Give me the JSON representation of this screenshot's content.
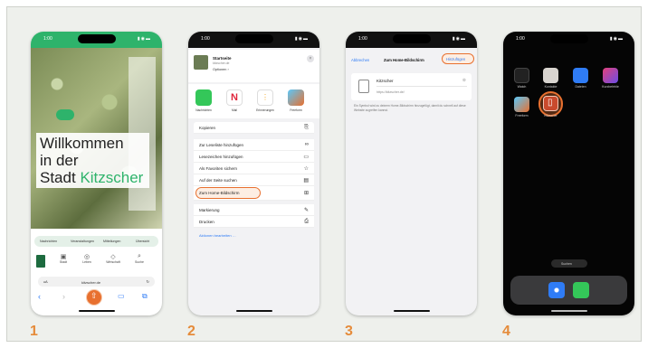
{
  "colors": {
    "accent_green": "#2eb36b",
    "highlight_orange": "#e8702f",
    "step_number": "#e58b3a",
    "ios_blue": "#2f7cf6"
  },
  "step_numbers": [
    "1",
    "2",
    "3",
    "4"
  ],
  "phone1": {
    "time": "1:00",
    "hero_line1": "Willkommen",
    "hero_line2": "in der",
    "hero_line3a": "Stadt",
    "hero_line3b": "Kitzscher",
    "chips": [
      "Nachrichten",
      "Veranstaltungen",
      "Mitteilungen"
    ],
    "chip_more": "Übersicht",
    "nav_items": [
      "Stadt",
      "Leben",
      "Wirtschaft",
      "Suche"
    ],
    "url": "kitzscher.de"
  },
  "phone2": {
    "time": "1:00",
    "page_title": "Startseite",
    "page_subtitle": "kitzscher.de",
    "options": "Optionen ›",
    "share_targets": [
      "Nachrichten",
      "Mail",
      "Erinnerungen",
      "Freeform"
    ],
    "menu_items": [
      "Kopieren",
      "Zur Leseliste hinzufügen",
      "Lesezeichen hinzufügen",
      "Als Favoriten sichern",
      "Auf der Seite suchen",
      "Zum Home-Bildschirm",
      "Markierung",
      "Drucken"
    ],
    "edit_actions": "Aktionen bearbeiten …"
  },
  "phone3": {
    "time": "1:00",
    "cancel": "Abbrechen",
    "title": "Zum Home-Bildschirm",
    "add": "Hinzufügen",
    "name_value": "Kitzscher",
    "url_value": "https://kitzscher.de/",
    "hint": "Ein Symbol wird zu deinem Home-Bildschirm hinzugefügt, damit du schnell auf diese Website zugreifen kannst."
  },
  "phone4": {
    "time": "1:00",
    "apps": [
      "Watch",
      "Kontakte",
      "Dateien",
      "Kurzbefehle",
      "Freeform",
      "Kitzscher"
    ],
    "search": "Suchen"
  }
}
